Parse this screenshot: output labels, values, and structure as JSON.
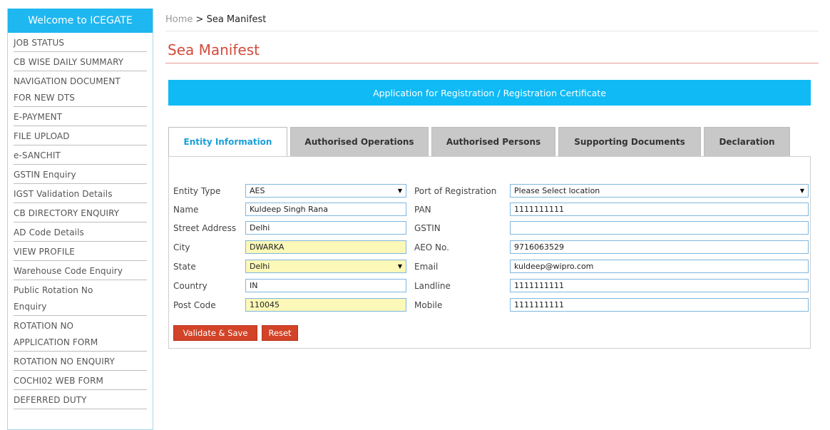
{
  "sidebar": {
    "header": "Welcome to ICEGATE",
    "items": [
      {
        "lines": [
          "JOB STATUS"
        ]
      },
      {
        "lines": [
          "CB WISE DAILY SUMMARY"
        ]
      },
      {
        "lines": [
          "NAVIGATION DOCUMENT",
          "FOR NEW DTS"
        ]
      },
      {
        "lines": [
          "E-PAYMENT"
        ]
      },
      {
        "lines": [
          "FILE UPLOAD"
        ]
      },
      {
        "lines": [
          "e-SANCHIT"
        ]
      },
      {
        "lines": [
          "GSTIN Enquiry"
        ]
      },
      {
        "lines": [
          "IGST Validation Details"
        ]
      },
      {
        "lines": [
          "CB DIRECTORY ENQUIRY"
        ]
      },
      {
        "lines": [
          "AD Code Details"
        ]
      },
      {
        "lines": [
          "VIEW PROFILE"
        ]
      },
      {
        "lines": [
          "Warehouse Code Enquiry"
        ]
      },
      {
        "lines": [
          "Public Rotation No",
          "Enquiry"
        ]
      },
      {
        "lines": [
          "ROTATION NO",
          "APPLICATION FORM"
        ]
      },
      {
        "lines": [
          "ROTATION NO ENQUIRY"
        ]
      },
      {
        "lines": [
          "COCHI02 WEB FORM"
        ]
      },
      {
        "lines": [
          "DEFERRED DUTY"
        ]
      }
    ]
  },
  "breadcrumb": {
    "home": "Home",
    "separator": ">",
    "current": "Sea Manifest"
  },
  "page_title": "Sea Manifest",
  "banner": "Application for Registration / Registration Certificate",
  "tabs": [
    {
      "label": "Entity Information",
      "active": true
    },
    {
      "label": "Authorised Operations",
      "active": false
    },
    {
      "label": "Authorised Persons",
      "active": false
    },
    {
      "label": "Supporting Documents",
      "active": false
    },
    {
      "label": "Declaration",
      "active": false
    }
  ],
  "form": {
    "left": [
      {
        "label": "Entity Type",
        "value": "AES",
        "type": "select",
        "highlight": false
      },
      {
        "label": "Name",
        "value": "Kuldeep Singh Rana",
        "type": "text",
        "highlight": false
      },
      {
        "label": "Street Address",
        "value": "Delhi",
        "type": "text",
        "highlight": false
      },
      {
        "label": "City",
        "value": "DWARKA",
        "type": "text",
        "highlight": true
      },
      {
        "label": "State",
        "value": "Delhi",
        "type": "select",
        "highlight": true
      },
      {
        "label": "Country",
        "value": "IN",
        "type": "text",
        "highlight": false
      },
      {
        "label": "Post Code",
        "value": "110045",
        "type": "text",
        "highlight": true
      }
    ],
    "right": [
      {
        "label": "Port of Registration",
        "value": "Please Select location",
        "type": "select"
      },
      {
        "label": "PAN",
        "value": "1111111111",
        "type": "text"
      },
      {
        "label": "GSTIN",
        "value": "",
        "type": "text"
      },
      {
        "label": "AEO No.",
        "value": "9716063529",
        "type": "text"
      },
      {
        "label": "Email",
        "value": "kuldeep@wipro.com",
        "type": "text"
      },
      {
        "label": "Landline",
        "value": "1111111111",
        "type": "text"
      },
      {
        "label": "Mobile",
        "value": "1111111111",
        "type": "text"
      }
    ]
  },
  "buttons": {
    "validate_save": "Validate & Save",
    "reset": "Reset"
  },
  "colors": {
    "accent_blue": "#1fb7f0",
    "title_red": "#d24b3c",
    "button_red": "#d24327",
    "highlight_yellow": "#fbf8b8"
  }
}
